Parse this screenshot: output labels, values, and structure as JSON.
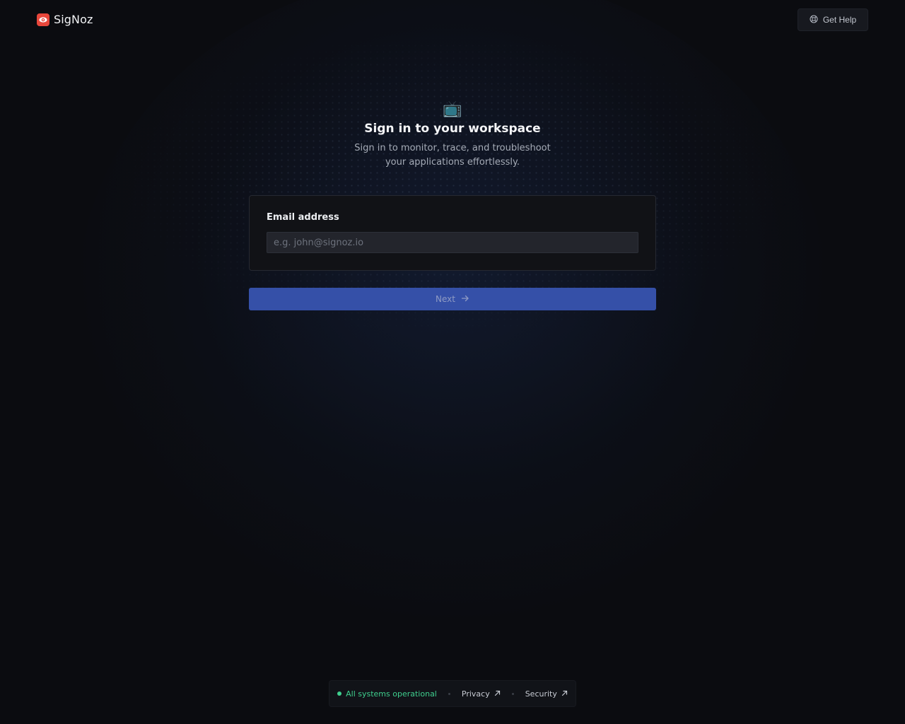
{
  "header": {
    "brand_name": "SigNoz",
    "help_label": "Get Help",
    "help_icon": "help-circle-icon"
  },
  "hero": {
    "icon": "📺",
    "title": "Sign in to your workspace",
    "subtitle": "Sign in to monitor, trace, and troubleshoot your applications effortlessly."
  },
  "form": {
    "email_label": "Email address",
    "email_placeholder": "e.g. john@signoz.io",
    "email_value": "",
    "next_label": "Next"
  },
  "footer": {
    "status_text": "All systems operational",
    "privacy_label": "Privacy",
    "security_label": "Security"
  },
  "colors": {
    "background": "#0b0c10",
    "brand_red": "#e8473b",
    "primary_button": "#3550a8",
    "status_green": "#3fcf8e"
  }
}
